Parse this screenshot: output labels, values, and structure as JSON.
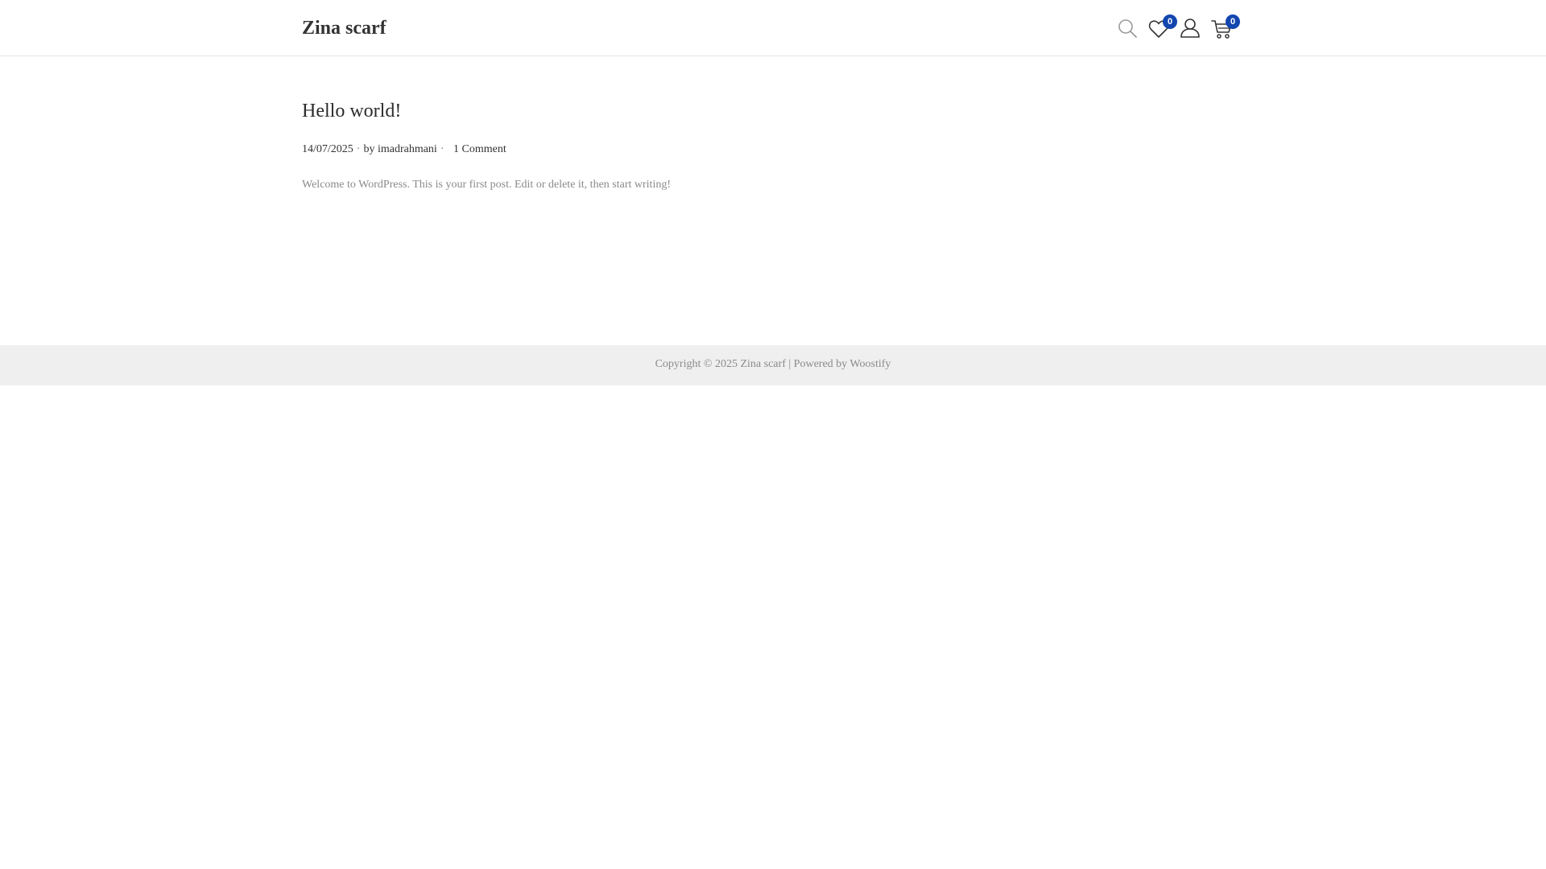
{
  "header": {
    "site_title": "Zina scarf",
    "wishlist_count": "0",
    "cart_count": "0",
    "icons": [
      "search-icon",
      "heart-icon",
      "user-icon",
      "cart-icon"
    ],
    "badge_color": "#1346af"
  },
  "post": {
    "title": "Hello world!",
    "date": "14/07/2025",
    "by_label": "by",
    "author": "imadrahmani",
    "comments": "1 Comment",
    "excerpt": "Welcome to WordPress. This is your first post. Edit or delete it, then start writing!"
  },
  "footer": {
    "copyright": "Copyright © 2025 Zina scarf",
    "divider": "|",
    "powered_label": "Powered by",
    "powered_link": "Woostify",
    "background": "#efefef"
  }
}
